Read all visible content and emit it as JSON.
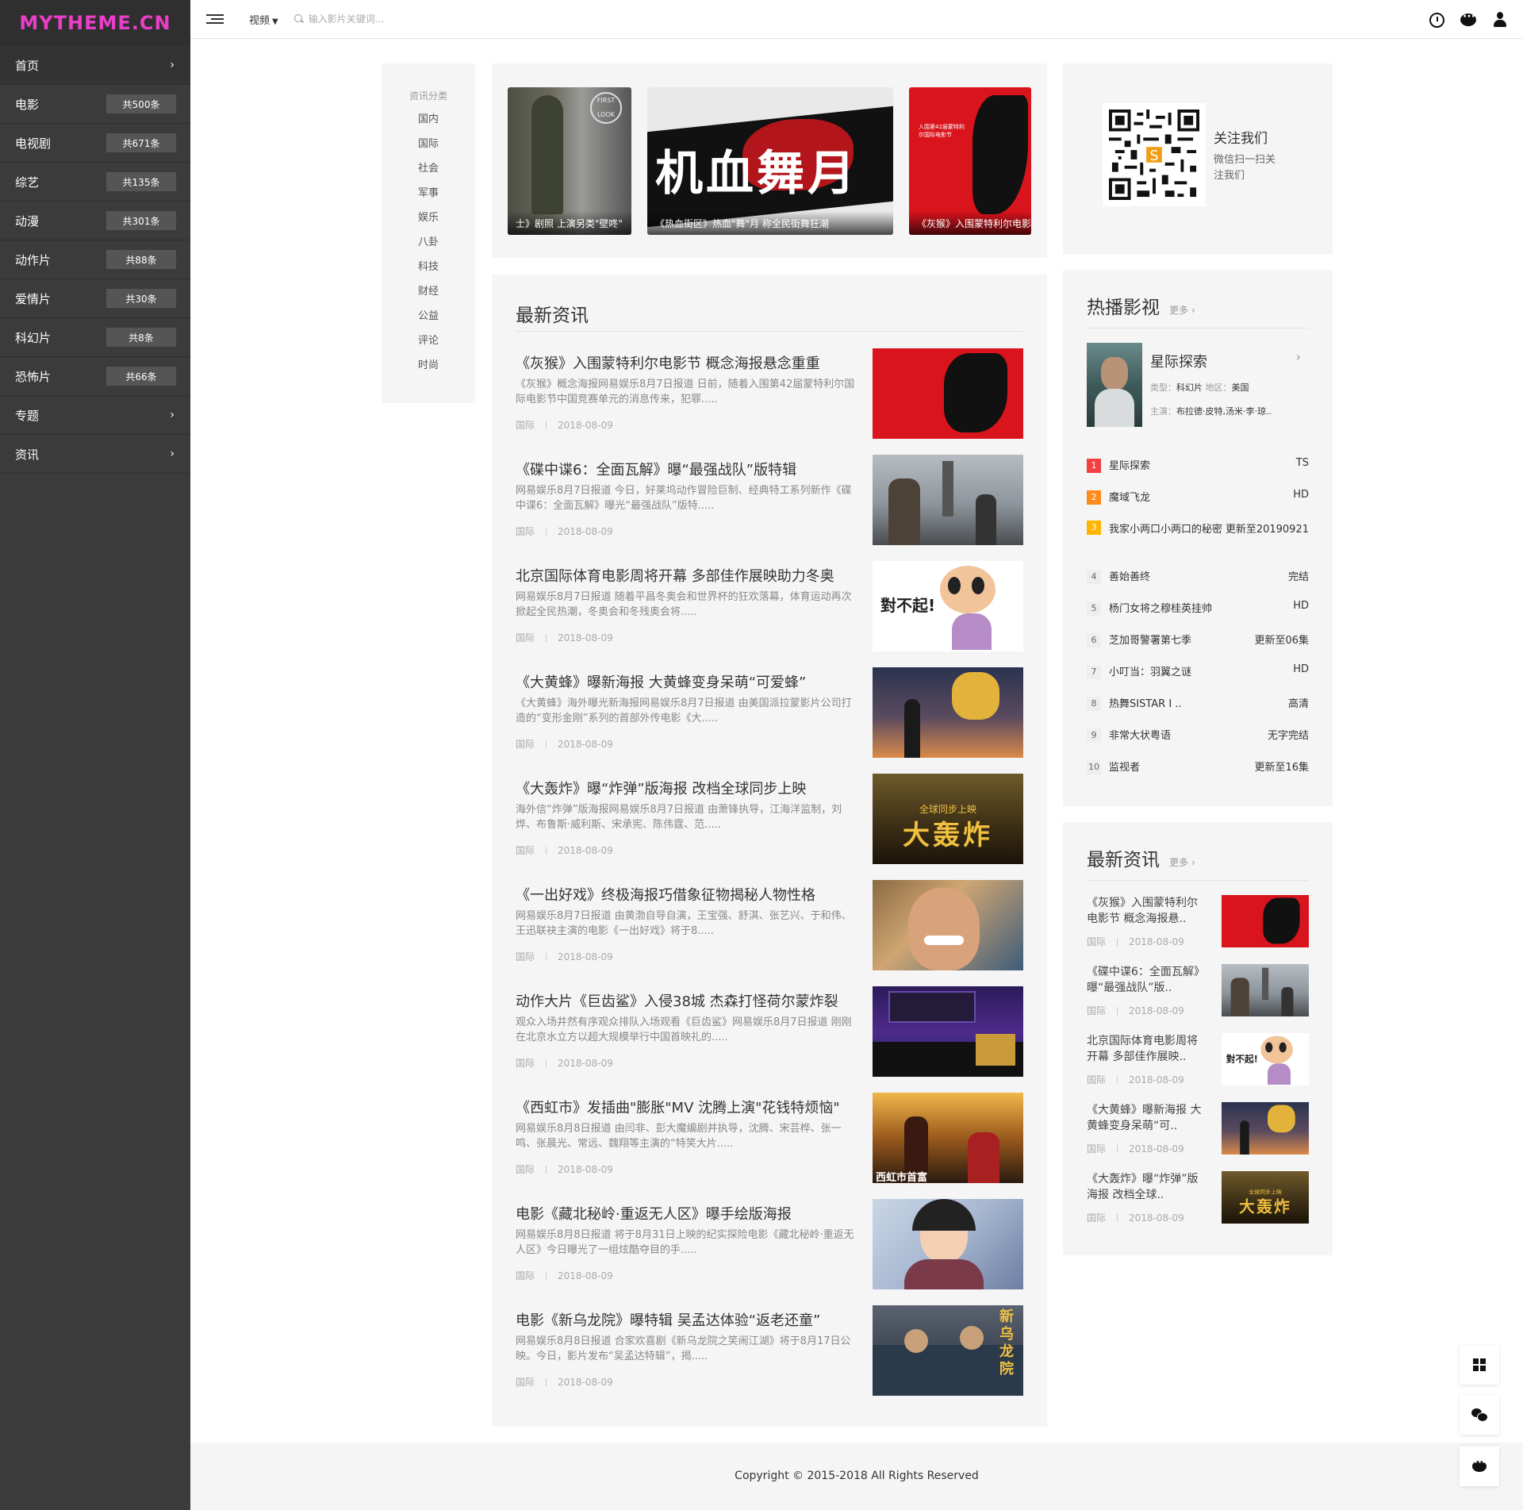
{
  "brand": {
    "logo": "MYTHEME.CN",
    "logo_color": "#e93fc8"
  },
  "sidebar": {
    "items": [
      {
        "label": "首页",
        "badge": "",
        "chevron": true
      },
      {
        "label": "电影",
        "badge": "共500条",
        "chevron": false
      },
      {
        "label": "电视剧",
        "badge": "共671条",
        "chevron": false
      },
      {
        "label": "综艺",
        "badge": "共135条",
        "chevron": false
      },
      {
        "label": "动漫",
        "badge": "共301条",
        "chevron": false
      },
      {
        "label": "动作片",
        "badge": "共88条",
        "chevron": false
      },
      {
        "label": "爱情片",
        "badge": "共30条",
        "chevron": false
      },
      {
        "label": "科幻片",
        "badge": "共8条",
        "chevron": false
      },
      {
        "label": "恐怖片",
        "badge": "共66条",
        "chevron": false
      },
      {
        "label": "专题",
        "badge": "",
        "chevron": true
      },
      {
        "label": "资讯",
        "badge": "",
        "chevron": true
      }
    ]
  },
  "topbar": {
    "search_type": "视频",
    "search_placeholder": "输入影片关键词...",
    "icons": [
      "clock-icon",
      "message-icon",
      "user-icon"
    ]
  },
  "categories": {
    "title": "资讯分类",
    "items": [
      "国内",
      "国际",
      "社会",
      "军事",
      "娱乐",
      "八卦",
      "科技",
      "财经",
      "公益",
      "评论",
      "时尚"
    ]
  },
  "banner": {
    "slides": [
      {
        "caption": "士》剧照 上演另类\"壁咚\""
      },
      {
        "caption": "《热血街区》热血\"舞\"月 称全民街舞狂潮"
      },
      {
        "caption": "《灰猴》入围蒙特利尔电影节"
      }
    ]
  },
  "news": {
    "title": "最新资讯",
    "items": [
      {
        "title": "《灰猴》入围蒙特利尔电影节 概念海报悬念重重",
        "desc": "《灰猴》概念海报网易娱乐8月7日报道 日前，随着入围第42届蒙特利尔国际电影节中国竞赛单元的消息传来，犯罪.....",
        "category": "国际",
        "date": "2018-08-09"
      },
      {
        "title": "《碟中谍6：全面瓦解》曝“最强战队”版特辑",
        "desc": "网易娱乐8月7日报道 今日，好莱坞动作冒险巨制、经典特工系列新作《碟中谍6：全面瓦解》曝光“最强战队”版特.....",
        "category": "国际",
        "date": "2018-08-09"
      },
      {
        "title": "北京国际体育电影周将开幕 多部佳作展映助力冬奥",
        "desc": "网易娱乐8月7日报道 随着平昌冬奥会和世界杯的狂欢落幕，体育运动再次掀起全民热潮，冬奥会和冬残奥会将.....",
        "category": "国际",
        "date": "2018-08-09"
      },
      {
        "title": "《大黄蜂》曝新海报 大黄蜂变身呆萌“可爱蜂”",
        "desc": "《大黄蜂》海外曝光新海报网易娱乐8月7日报道 由美国派拉蒙影片公司打造的“变形金刚”系列的首部外传电影《大.....",
        "category": "国际",
        "date": "2018-08-09"
      },
      {
        "title": "《大轰炸》曝“炸弹”版海报 改档全球同步上映",
        "desc": "海外信“炸弹”版海报网易娱乐8月7日报道 由萧锋执导，江海洋监制，刘烨、布鲁斯·威利斯、宋承宪、陈伟霆、范.....",
        "category": "国际",
        "date": "2018-08-09"
      },
      {
        "title": "《一出好戏》终极海报巧借象征物揭秘人物性格",
        "desc": "网易娱乐8月7日报道 由黄渤自导自演，王宝强、舒淇、张艺兴、于和伟、王迅联袂主演的电影《一出好戏》将于8.....",
        "category": "国际",
        "date": "2018-08-09"
      },
      {
        "title": "动作大片《巨齿鲨》入侵38城 杰森打怪荷尔蒙炸裂",
        "desc": "观众入场井然有序观众排队入场观看《巨齿鲨》网易娱乐8月7日报道 刚刚在北京水立方以超大规模举行中国首映礼的.....",
        "category": "国际",
        "date": "2018-08-09"
      },
      {
        "title": "《西虹市》发插曲\"膨胀\"MV 沈腾上演\"花钱特烦恼\"",
        "desc": "网易娱乐8月8日报道 由闫非、彭大魔编剧并执导，沈腾、宋芸桦、张一鸣、张晨光、常远、魏翔等主演的“特笑大片.....",
        "category": "国际",
        "date": "2018-08-09"
      },
      {
        "title": "电影《藏北秘岭·重返无人区》曝手绘版海报",
        "desc": "网易娱乐8月8日报道 将于8月31日上映的纪实探险电影《藏北秘岭·重返无人区》今日曝光了一组炫酷夺目的手.....",
        "category": "国际",
        "date": "2018-08-09"
      },
      {
        "title": "电影《新乌龙院》曝特辑 吴孟达体验“返老还童”",
        "desc": "网易娱乐8月8日报道 合家欢喜剧《新乌龙院之笑闹江湖》将于8月17日公映。今日，影片发布“吴孟达特辑”，揭.....",
        "category": "国际",
        "date": "2018-08-09"
      }
    ]
  },
  "follow": {
    "title": "关注我们",
    "subtitle": "微信扫一扫关注我们"
  },
  "hot": {
    "title": "热播影视",
    "more": "更多 ›",
    "featured": {
      "title": "星际探索",
      "type_label": "类型：",
      "type": "科幻片",
      "region_label": " 地区：",
      "region": "美国",
      "cast_label": "主演：",
      "cast": "布拉德·皮特,汤米·李·琼.."
    },
    "ranking": [
      {
        "num": "1",
        "name": "星际探索",
        "status": "TS"
      },
      {
        "num": "2",
        "name": "魔域飞龙",
        "status": "HD"
      },
      {
        "num": "3",
        "name": "我家小两口小两口的秘密",
        "status": "更新至20190921"
      },
      {
        "num": "4",
        "name": "善始善终",
        "status": "完结"
      },
      {
        "num": "5",
        "name": "杨门女将之穆桂英挂帅",
        "status": "HD"
      },
      {
        "num": "6",
        "name": "芝加哥警署第七季",
        "status": "更新至06集"
      },
      {
        "num": "7",
        "name": "小叮当：羽翼之谜",
        "status": "HD"
      },
      {
        "num": "8",
        "name": "热舞SISTAR I ..",
        "status": "高清"
      },
      {
        "num": "9",
        "name": "非常大状粤语",
        "status": "无字完结"
      },
      {
        "num": "10",
        "name": "监视者",
        "status": "更新至16集"
      }
    ]
  },
  "latest": {
    "title": "最新资讯",
    "more": "更多 ›",
    "items": [
      {
        "title": "《灰猴》入围蒙特利尔电影节 概念海报悬..",
        "category": "国际",
        "date": "2018-08-09"
      },
      {
        "title": "《碟中谍6：全面瓦解》曝“最强战队”版..",
        "category": "国际",
        "date": "2018-08-09"
      },
      {
        "title": "北京国际体育电影周将开幕 多部佳作展映..",
        "category": "国际",
        "date": "2018-08-09"
      },
      {
        "title": "《大黄蜂》曝新海报 大黄蜂变身呆萌“可..",
        "category": "国际",
        "date": "2018-08-09"
      },
      {
        "title": "《大轰炸》曝“炸弹”版海报 改档全球..",
        "category": "国际",
        "date": "2018-08-09"
      }
    ]
  },
  "footer": {
    "copyright": "Copyright © 2015-2018 All Rights Reserved"
  }
}
